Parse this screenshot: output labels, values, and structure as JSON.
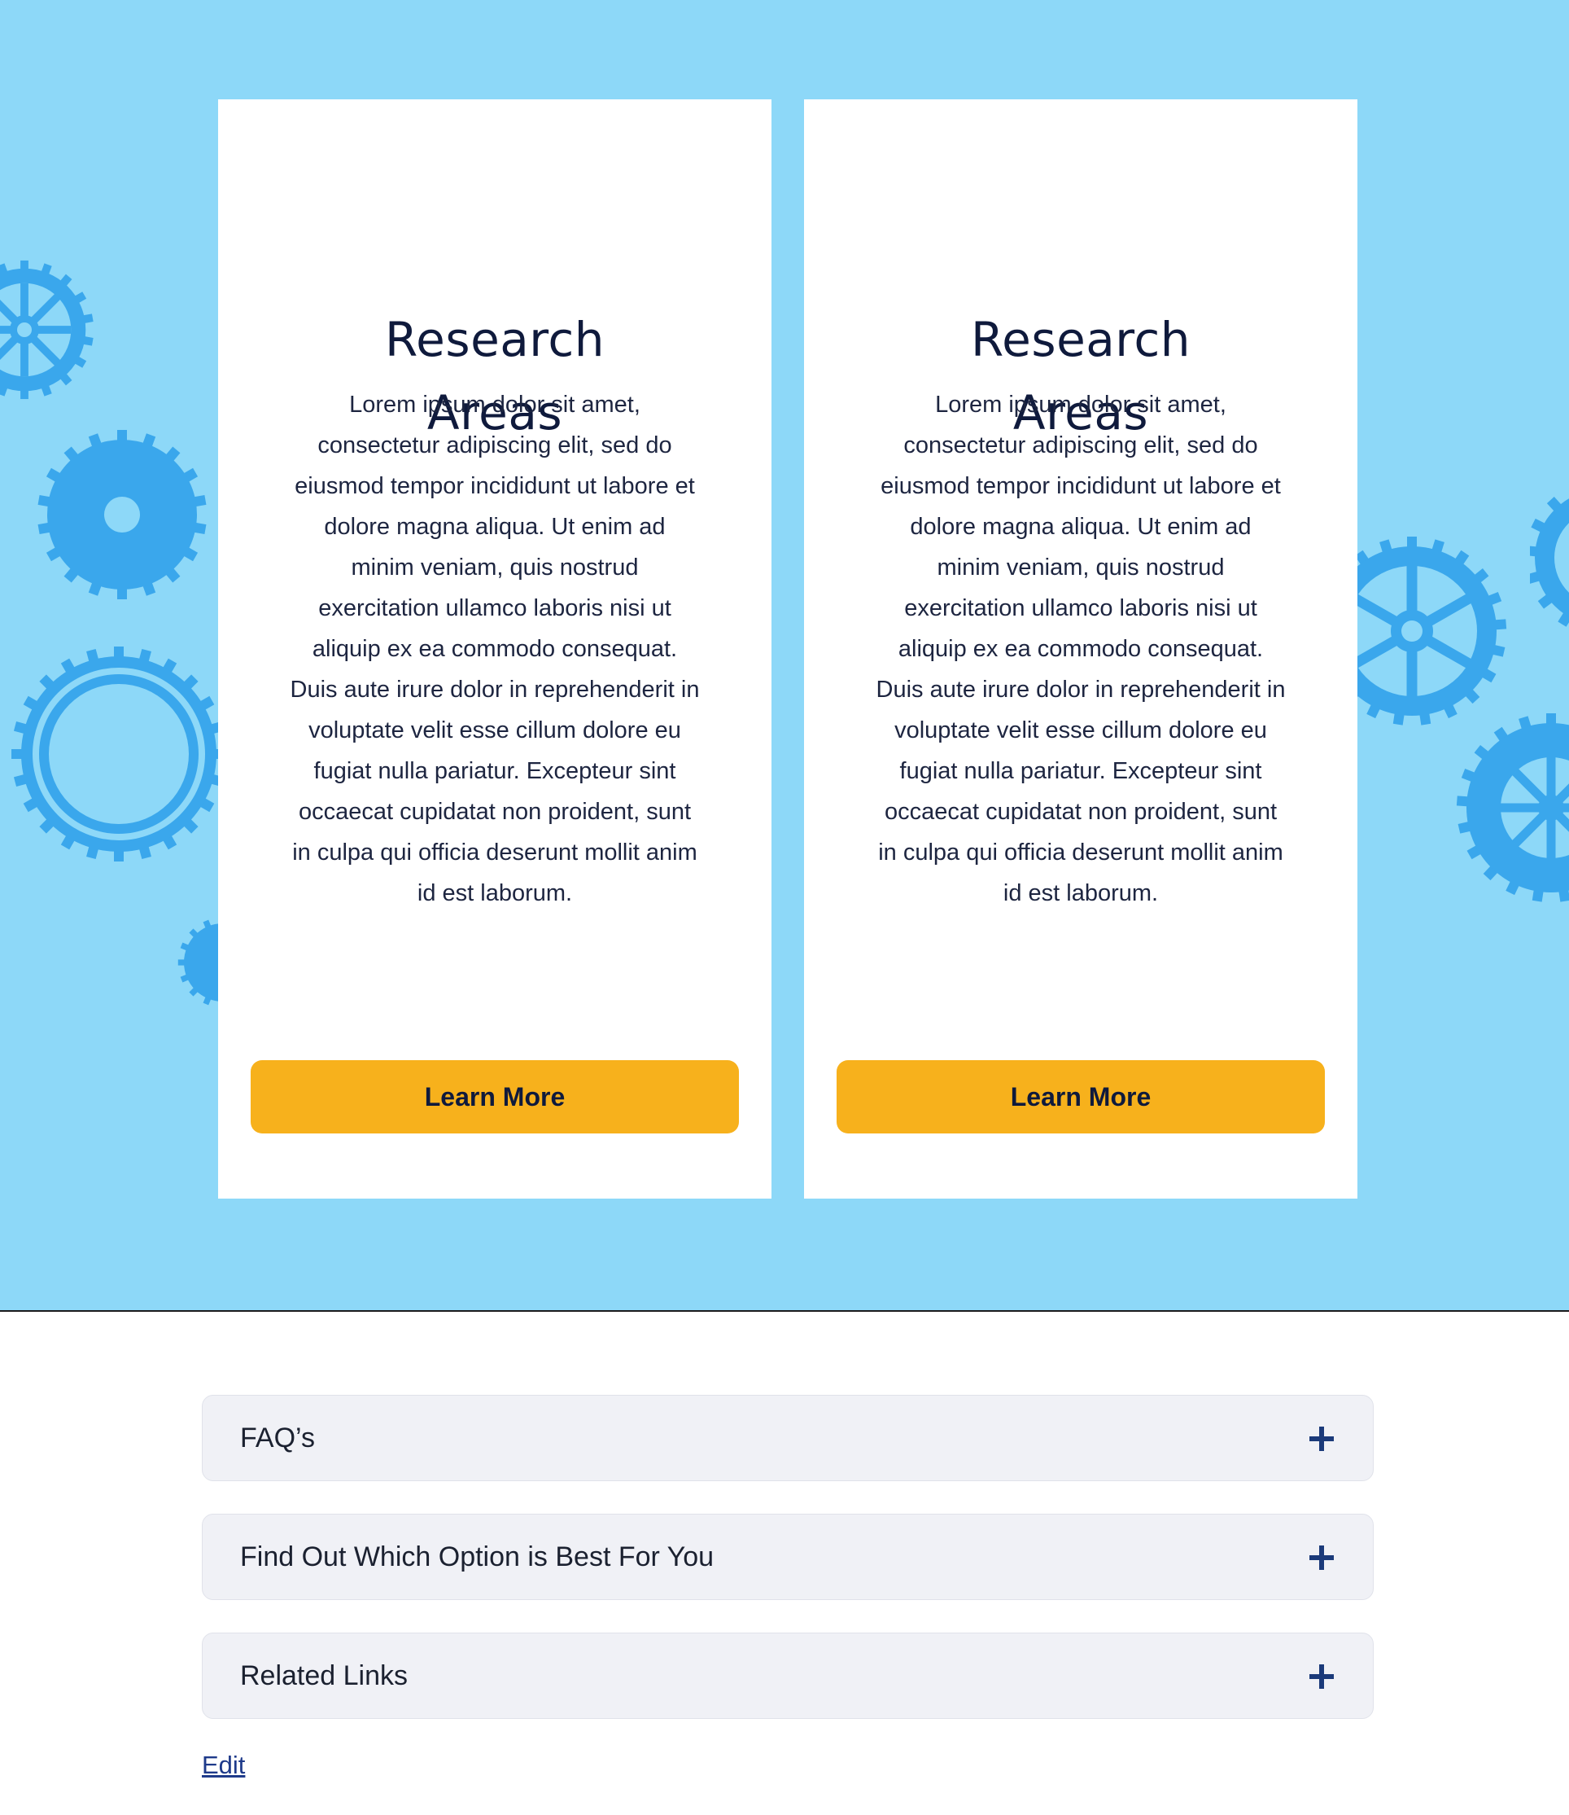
{
  "colors": {
    "hero_background": "#8dd8f8",
    "gear": "#3aa7ec",
    "button": "#f7b11c",
    "title_text": "#0f1a3c",
    "accordion_bg": "#f0f1f6",
    "plus_icon": "#1b3a7a",
    "link": "#1e3a8a"
  },
  "cards": [
    {
      "title": "Research\nAreas",
      "body": "Lorem ipsum dolor sit amet, consectetur adipiscing elit, sed do eiusmod tempor incididunt ut labore et dolore magna aliqua. Ut enim ad minim veniam, quis nostrud exercitation ullamco laboris nisi ut aliquip ex ea commodo consequat. Duis aute irure dolor in reprehenderit in voluptate velit esse cillum dolore eu fugiat nulla pariatur. Excepteur sint occaecat cupidatat non proident, sunt in culpa qui officia deserunt mollit anim id est laborum.",
      "button_label": "Learn More"
    },
    {
      "title": "Research\nAreas",
      "body": "Lorem ipsum dolor sit amet, consectetur adipiscing elit, sed do eiusmod tempor incididunt ut labore et dolore magna aliqua. Ut enim ad minim veniam, quis nostrud exercitation ullamco laboris nisi ut aliquip ex ea commodo consequat. Duis aute irure dolor in reprehenderit in voluptate velit esse cillum dolore eu fugiat nulla pariatur. Excepteur sint occaecat cupidatat non proident, sunt in culpa qui officia deserunt mollit anim id est laborum.",
      "button_label": "Learn More"
    }
  ],
  "accordions": [
    {
      "label": "FAQ’s",
      "icon": "plus-icon"
    },
    {
      "label": "Find Out Which Option is Best For You",
      "icon": "plus-icon"
    },
    {
      "label": "Related Links",
      "icon": "plus-icon"
    }
  ],
  "edit_link": "Edit"
}
